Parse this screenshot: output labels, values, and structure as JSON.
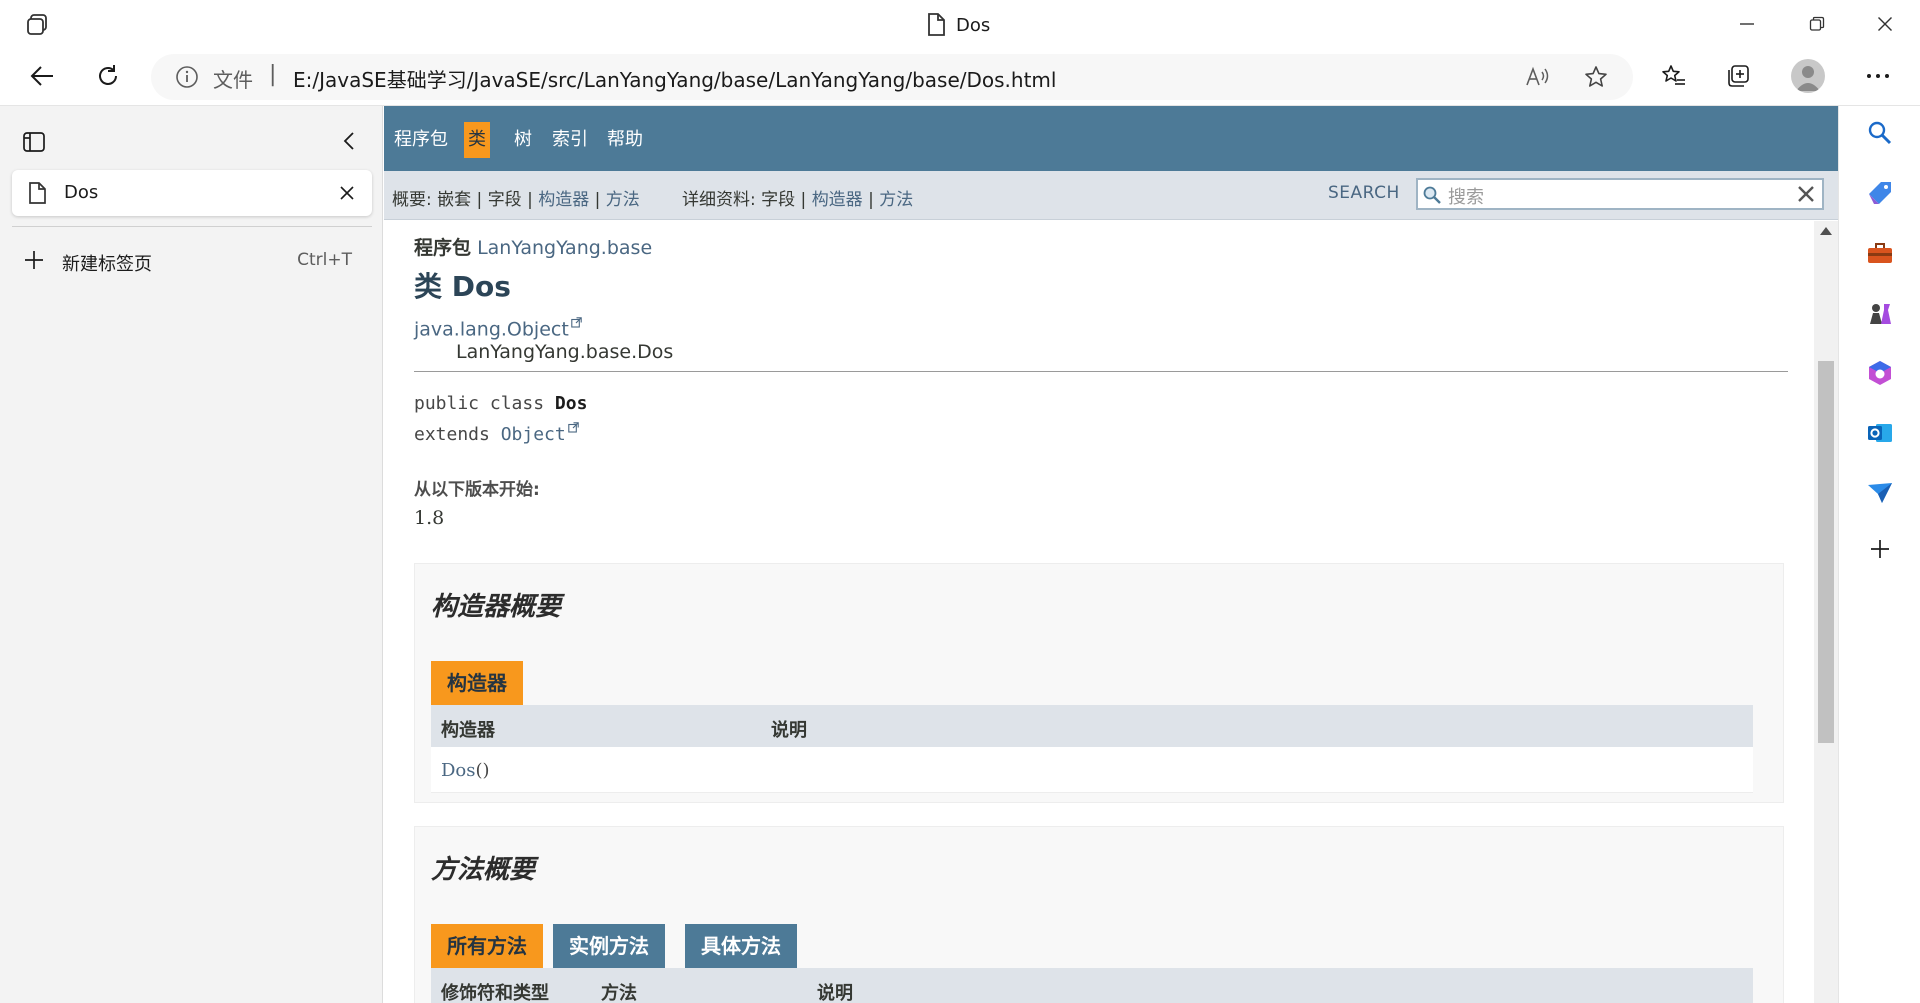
{
  "window": {
    "tab_title": "Dos"
  },
  "address_bar": {
    "label": "文件",
    "separator": "|",
    "url": "E:/JavaSE基础学习/JavaSE/src/LanYangYang/base/LanYangYang/base/Dos.html"
  },
  "vertical_tabs": {
    "tabs": [
      {
        "label": "Dos"
      }
    ],
    "new_tab_label": "新建标签页",
    "new_tab_shortcut": "Ctrl+T"
  },
  "javadoc": {
    "nav": [
      {
        "label": "程序包",
        "active": false
      },
      {
        "label": "类",
        "active": true
      },
      {
        "label": "树",
        "active": false
      },
      {
        "label": "索引",
        "active": false
      },
      {
        "label": "帮助",
        "active": false
      }
    ],
    "subnav": {
      "summary_prefix": "概要:",
      "summary_items": [
        "嵌套",
        "字段",
        "构造器",
        "方法"
      ],
      "detail_prefix": "详细资料:",
      "detail_items": [
        "字段",
        "构造器",
        "方法"
      ],
      "sep": "|"
    },
    "search": {
      "label": "SEARCH",
      "placeholder": "搜索"
    },
    "package_label": "程序包",
    "package_name": "LanYangYang.base",
    "class_title": "类 Dos",
    "inheritance": [
      "java.lang.Object",
      "LanYangYang.base.Dos"
    ],
    "signature": {
      "modifiers": "public class ",
      "name": "Dos",
      "extends_kw": "extends ",
      "extends_type": "Object"
    },
    "since_label": "从以下版本开始:",
    "since_value": "1.8",
    "constructor_summary": {
      "title": "构造器概要",
      "tab": "构造器",
      "columns": [
        "构造器",
        "说明"
      ],
      "rows": [
        {
          "name": "Dos",
          "params": "()"
        }
      ]
    },
    "method_summary": {
      "title": "方法概要",
      "tabs": [
        {
          "label": "所有方法",
          "active": true
        },
        {
          "label": "实例方法",
          "active": false
        },
        {
          "label": "具体方法",
          "active": false
        }
      ],
      "columns": [
        "修饰符和类型",
        "方法",
        "说明"
      ]
    }
  },
  "colors": {
    "nav_bg": "#4d7a97",
    "accent_orange": "#f8981d",
    "subnav_bg": "#dee3e9",
    "link": "#4a6782"
  }
}
